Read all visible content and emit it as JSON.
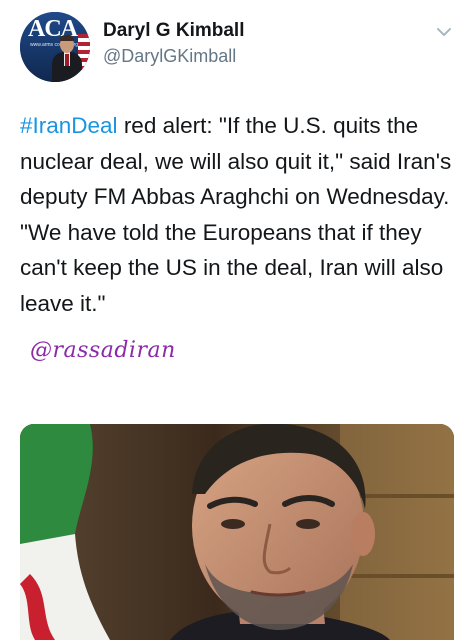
{
  "tweet": {
    "author_name": "Daryl G Kimball",
    "author_handle": "@DarylGKimball",
    "avatar": {
      "logo_text": "ACA",
      "url_text": "www.arms control.org"
    },
    "hashtag": "#IranDeal",
    "body_text": " red alert: \"If the U.S. quits the nuclear deal, we will also quit it,\" said Iran's deputy FM Abbas Araghchi on Wednesday. \"We have told the Europeans that if they can't keep the US in the deal, Iran will also leave it.\"",
    "watermark": "@rassadiran",
    "icons": {
      "menu": "chevron-down-icon"
    },
    "colors": {
      "hashtag": "#1b95e0",
      "handle": "#657786",
      "watermark": "#8a2aa8"
    }
  }
}
